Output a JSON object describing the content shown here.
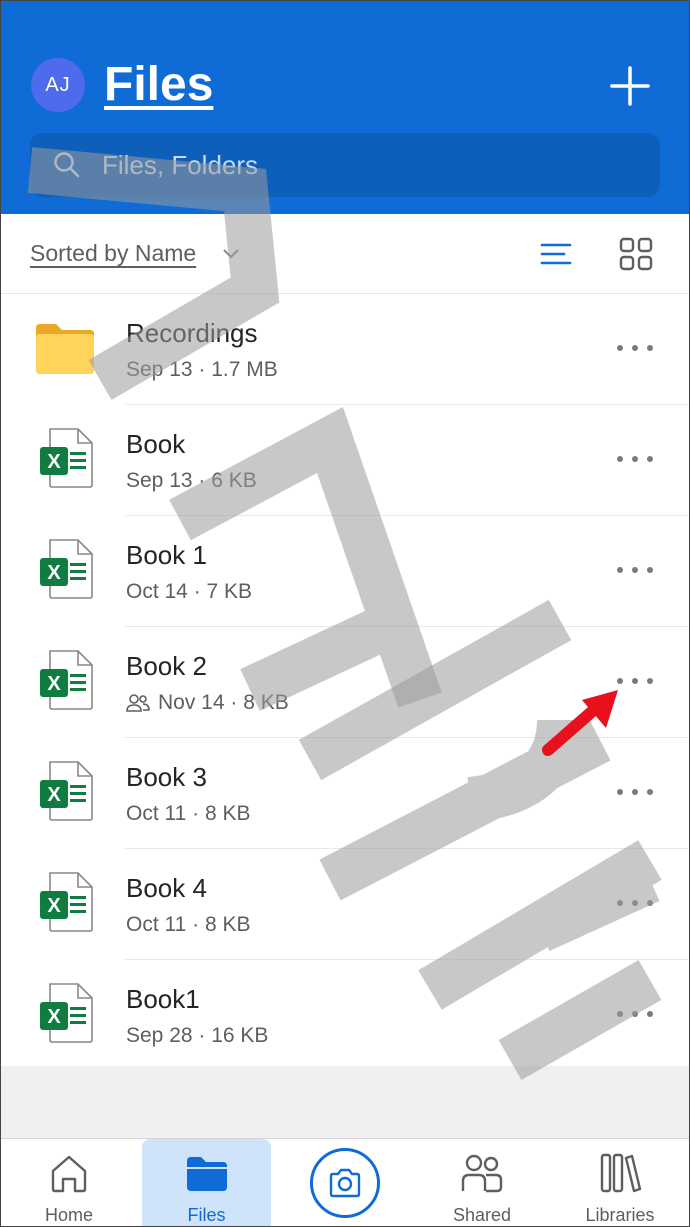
{
  "header": {
    "avatar_initials": "AJ",
    "title": "Files",
    "add_icon": "plus-icon"
  },
  "search": {
    "placeholder": "Files, Folders",
    "icon": "search-icon"
  },
  "sort_bar": {
    "sort_label": "Sorted by Name",
    "list_view_icon": "list-view-icon",
    "grid_view_icon": "grid-view-icon"
  },
  "files": [
    {
      "name": "Recordings",
      "meta": "Sep 13 · 1.7 MB",
      "type": "folder",
      "shared": false
    },
    {
      "name": "Book",
      "meta": "Sep 13 · 6 KB",
      "type": "excel",
      "shared": false
    },
    {
      "name": "Book 1",
      "meta": "Oct 14 · 7 KB",
      "type": "excel",
      "shared": false
    },
    {
      "name": "Book 2",
      "meta": "Nov 14 · 8 KB",
      "type": "excel",
      "shared": true
    },
    {
      "name": "Book 3",
      "meta": "Oct 11 · 8 KB",
      "type": "excel",
      "shared": false
    },
    {
      "name": "Book 4",
      "meta": "Oct 11 · 8 KB",
      "type": "excel",
      "shared": false
    },
    {
      "name": "Book1",
      "meta": "Sep 28 · 16 KB",
      "type": "excel",
      "shared": false
    }
  ],
  "bottom_nav": {
    "home": "Home",
    "files": "Files",
    "shared": "Shared",
    "libraries": "Libraries"
  },
  "colors": {
    "brand_blue": "#0f6cd6",
    "excel_green": "#107c41",
    "folder_yellow": "#ffd35c",
    "annotation_red": "#e8101c"
  }
}
